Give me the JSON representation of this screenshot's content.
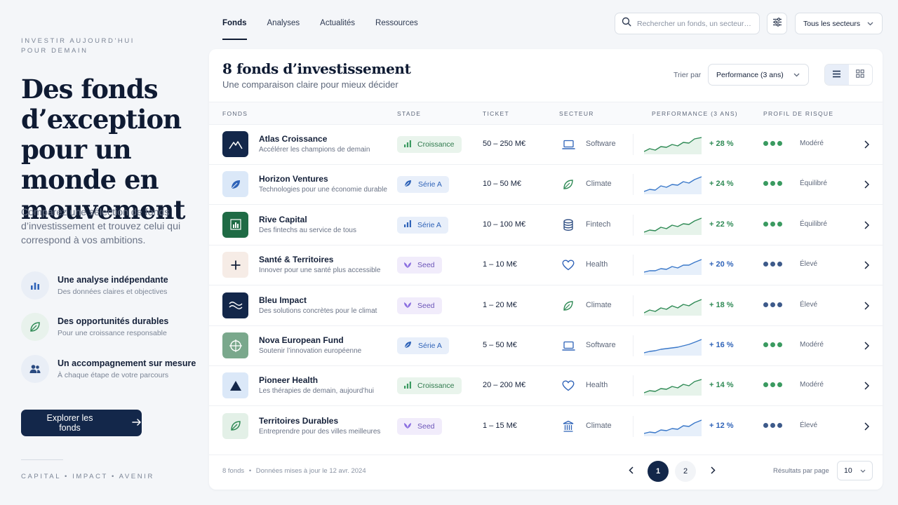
{
  "hero": {
    "eyebrow_line1": "INVESTIR AUJOURD'HUI",
    "eyebrow_line2": "POUR DEMAIN",
    "title": "Des fonds d’exception pour un monde en mouvement",
    "subtitle": "Comparez une sélection de fonds d’investissement et trouvez celui qui correspond à vos ambitions.",
    "features": [
      {
        "icon": "bar-chart-icon",
        "title": "Une analyse indépendante",
        "desc": "Des données claires et objectives"
      },
      {
        "icon": "leaf-icon",
        "title": "Des opportunités durables",
        "desc": "Pour une croissance responsable"
      },
      {
        "icon": "users-icon",
        "title": "Un accompagnement sur mesure",
        "desc": "À chaque étape de votre parcours"
      }
    ],
    "cta_label": "Explorer les fonds",
    "tagline": "CAPITAL  •  IMPACT  •  AVENIR"
  },
  "nav": {
    "items": [
      "Fonds",
      "Analyses",
      "Actualités",
      "Ressources"
    ],
    "active": "Fonds"
  },
  "search": {
    "placeholder": "Rechercher un fonds, un secteur…"
  },
  "sector_filter": {
    "selected": "Tous les secteurs"
  },
  "panel": {
    "title": "8 fonds d’investissement",
    "subtitle": "Une comparaison claire pour mieux décider",
    "sort_label": "Trier par",
    "sort_selected": "Performance (3 ans)"
  },
  "table": {
    "headers": [
      "FONDS",
      "STADE",
      "TICKET",
      "SECTEUR",
      "PERFORMANCE (3 ANS)",
      "PROFIL DE RISQUE"
    ],
    "rows": [
      {
        "name": "Atlas Croissance",
        "desc": "Accélérer les champions de demain",
        "logo": "mountain-icon",
        "stage": "Croissance",
        "ticket": "50 – 250 M€",
        "sector": "Software",
        "sector_icon": "laptop-icon",
        "perf": "+ 28 %",
        "risk": 3,
        "risk_label": "Modéré"
      },
      {
        "name": "Horizon Ventures",
        "desc": "Technologies pour une économie durable",
        "logo": "leaf-icon",
        "stage": "Série A",
        "ticket": "10 – 50 M€",
        "sector": "Climate",
        "sector_icon": "leaf-icon",
        "perf": "+ 24 %",
        "risk": 3,
        "risk_label": "Équilibré"
      },
      {
        "name": "Rive Capital",
        "desc": "Des fintechs au service de tous",
        "logo": "bar-chart-icon",
        "stage": "Série A",
        "ticket": "10 – 100 M€",
        "sector": "Fintech",
        "sector_icon": "coins-icon",
        "perf": "+ 22 %",
        "risk": 3,
        "risk_label": "Équilibré"
      },
      {
        "name": "Santé & Territoires",
        "desc": "Innover pour une santé plus accessible",
        "logo": "plus-icon",
        "stage": "Seed",
        "ticket": "1 – 10 M€",
        "sector": "Health",
        "sector_icon": "heart-icon",
        "perf": "+ 20 %",
        "risk": 3,
        "risk_label": "Élevé"
      },
      {
        "name": "Bleu Impact",
        "desc": "Des solutions concrètes pour le climat",
        "logo": "waves-icon",
        "stage": "Seed",
        "ticket": "1 – 20 M€",
        "sector": "Climate",
        "sector_icon": "leaf-icon",
        "perf": "+ 18 %",
        "risk": 3,
        "risk_label": "Élevé"
      },
      {
        "name": "Nova European Fund",
        "desc": "Soutenir l’innovation européenne",
        "logo": "target-icon",
        "stage": "Série A",
        "ticket": "5 – 50 M€",
        "sector": "Software",
        "sector_icon": "laptop-icon",
        "perf": "+ 16 %",
        "risk": 3,
        "risk_label": "Modéré"
      },
      {
        "name": "Pioneer Health",
        "desc": "Les thérapies de demain, aujourd’hui",
        "logo": "triangle-icon",
        "stage": "Croissance",
        "ticket": "20 – 200 M€",
        "sector": "Health",
        "sector_icon": "heart-icon",
        "perf": "+ 14 %",
        "risk": 3,
        "risk_label": "Modéré"
      },
      {
        "name": "Territoires Durables",
        "desc": "Entreprendre pour des villes meilleures",
        "logo": "leaf-icon",
        "stage": "Seed",
        "ticket": "1 – 15 M€",
        "sector": "Climate",
        "sector_icon": "building-icon",
        "perf": "+ 12 %",
        "risk": 3,
        "risk_label": "Élevé"
      }
    ]
  },
  "footer": {
    "count": "8 fonds",
    "updated": "Données mises à jour le 12 avr. 2024",
    "pages": [
      "1",
      "2"
    ],
    "rpp_label": "Résultats par page",
    "rpp_value": "10"
  },
  "colors": {
    "navy": "#13274a",
    "green": "#2f8a55",
    "blue": "#2f63b8",
    "purple": "#7b5bd1"
  }
}
